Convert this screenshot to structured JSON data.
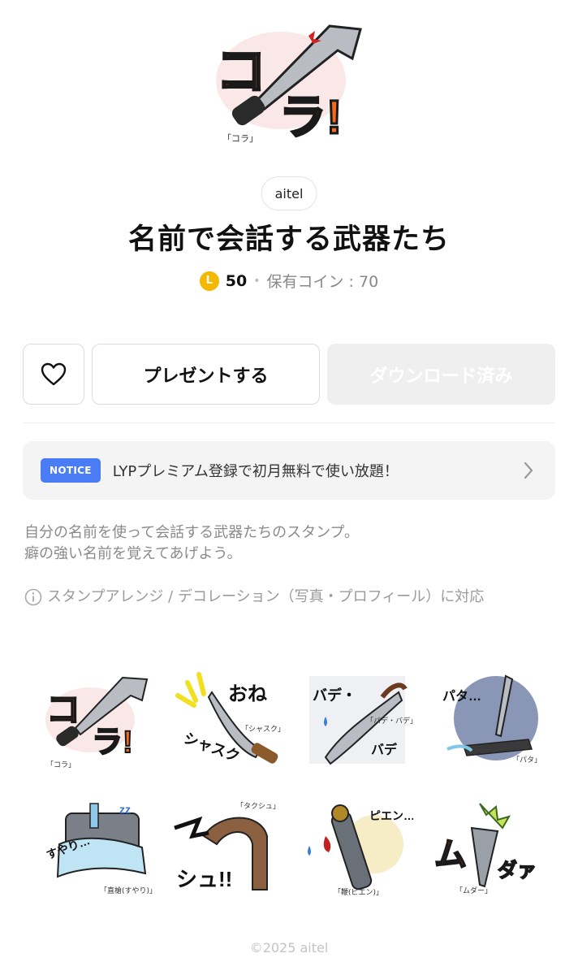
{
  "product": {
    "author": "aitel",
    "title": "名前で会話する武器たち",
    "price": "50",
    "coin_symbol": "L",
    "owned_coins": "保有コイン : 70"
  },
  "actions": {
    "favorite_icon": "heart-outline-icon",
    "present_label": "プレゼントする",
    "download_label": "ダウンロード済み"
  },
  "notice": {
    "badge": "NOTICE",
    "text": "LYPプレミアム登録で初月無料で使い放題！"
  },
  "description": {
    "line1": "自分の名前を使って会話する武器たちのスタンプ。",
    "line2": "癖の強い名前を覚えてあげよう。"
  },
  "arrange_note": "スタンプアレンジ / デコレーション（写真・プロフィール）に対応",
  "hero_caption": "「コラ」",
  "hero_text": "コラ!",
  "stickers": [
    {
      "bubble": "コラ!",
      "caption": "「コラ」"
    },
    {
      "bubble": "おねシャスク",
      "caption": "「シャスク」"
    },
    {
      "bubble": "バデ・",
      "caption": "「バデ・バデ」"
    },
    {
      "bubble": "パタ…",
      "caption": "「パタ」"
    },
    {
      "bubble": "すやり…",
      "caption": "「直槍(すやり)」"
    },
    {
      "bubble": "タクシュ!!",
      "caption": "「タクシュ」"
    },
    {
      "bubble": "ピエン…",
      "caption": "「鞭(ピエン)」"
    },
    {
      "bubble": "ムダァ",
      "caption": "「ムダー」"
    }
  ],
  "footer": "©2025 aitel",
  "colors": {
    "coin": "#f5b800",
    "notice_badge": "#4a7cf5",
    "download_bg": "#efefef"
  }
}
